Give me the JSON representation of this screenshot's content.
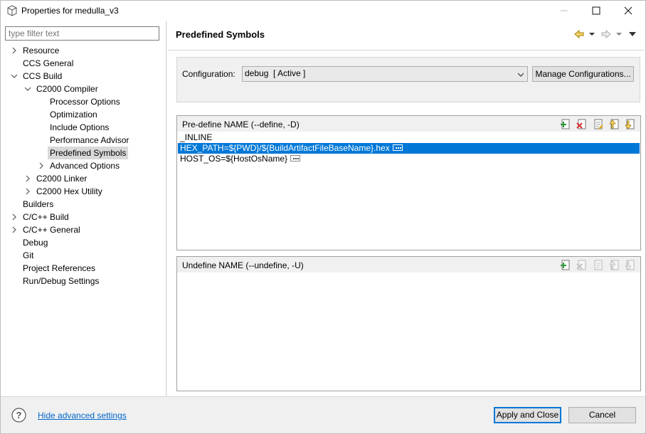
{
  "window": {
    "title": "Properties for medulla_v3",
    "controls": [
      "minimize-icon",
      "maximize-icon",
      "close-icon"
    ]
  },
  "filter": {
    "placeholder": "type filter text",
    "value": ""
  },
  "tree": [
    {
      "label": "Resource",
      "depth": 0,
      "twisty": "collapsed"
    },
    {
      "label": "CCS General",
      "depth": 0,
      "twisty": "none"
    },
    {
      "label": "CCS Build",
      "depth": 0,
      "twisty": "expanded"
    },
    {
      "label": "C2000 Compiler",
      "depth": 1,
      "twisty": "expanded"
    },
    {
      "label": "Processor Options",
      "depth": 2,
      "twisty": "none"
    },
    {
      "label": "Optimization",
      "depth": 2,
      "twisty": "none"
    },
    {
      "label": "Include Options",
      "depth": 2,
      "twisty": "none"
    },
    {
      "label": "Performance Advisor",
      "depth": 2,
      "twisty": "none"
    },
    {
      "label": "Predefined Symbols",
      "depth": 2,
      "twisty": "none",
      "selected": true
    },
    {
      "label": "Advanced Options",
      "depth": 2,
      "twisty": "collapsed"
    },
    {
      "label": "C2000 Linker",
      "depth": 1,
      "twisty": "collapsed"
    },
    {
      "label": "C2000 Hex Utility",
      "depth": 1,
      "twisty": "collapsed"
    },
    {
      "label": "Builders",
      "depth": 0,
      "twisty": "none"
    },
    {
      "label": "C/C++ Build",
      "depth": 0,
      "twisty": "collapsed"
    },
    {
      "label": "C/C++ General",
      "depth": 0,
      "twisty": "collapsed"
    },
    {
      "label": "Debug",
      "depth": 0,
      "twisty": "none"
    },
    {
      "label": "Git",
      "depth": 0,
      "twisty": "none"
    },
    {
      "label": "Project References",
      "depth": 0,
      "twisty": "none"
    },
    {
      "label": "Run/Debug Settings",
      "depth": 0,
      "twisty": "none"
    }
  ],
  "page": {
    "title": "Predefined Symbols"
  },
  "configuration": {
    "label": "Configuration:",
    "value": "debug  [ Active ]",
    "manage_label": "Manage Configurations..."
  },
  "define": {
    "title": "Pre-define NAME (--define, -D)",
    "items": [
      {
        "text": "_INLINE",
        "selected": false,
        "ellipsis": false
      },
      {
        "text": "HEX_PATH=${PWD}/${BuildArtifactFileBaseName}.hex",
        "selected": true,
        "ellipsis": true
      },
      {
        "text": "HOST_OS=${HostOsName}",
        "selected": false,
        "ellipsis": true
      }
    ]
  },
  "undefine": {
    "title": "Undefine NAME (--undefine, -U)",
    "items": []
  },
  "toolbar_icons": [
    "add-icon",
    "delete-icon",
    "edit-icon",
    "move-up-icon",
    "move-down-icon"
  ],
  "footer": {
    "link": "Hide advanced settings",
    "apply_label": "Apply and Close",
    "cancel_label": "Cancel"
  },
  "colors": {
    "selection": "#0078d7",
    "link": "#0066cc",
    "add": "#2e9b3a",
    "delete": "#d32f2f",
    "arrow": "#d9a400"
  }
}
